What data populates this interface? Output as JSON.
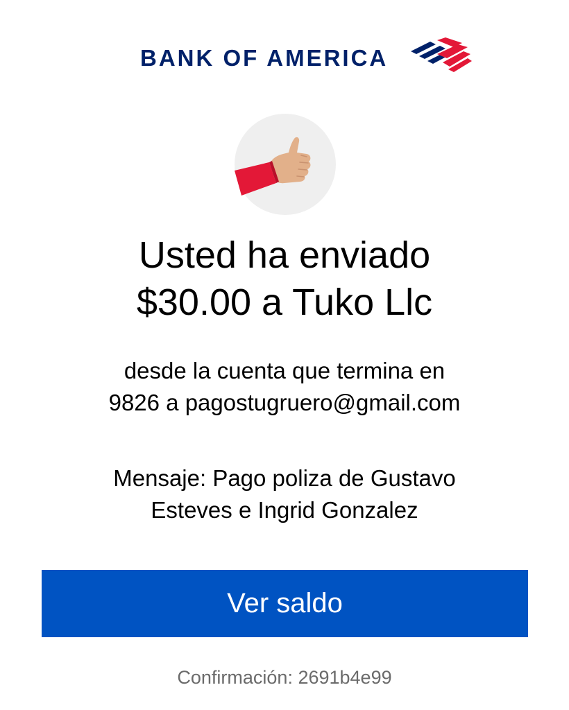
{
  "brand": {
    "name": "BANK OF AMERICA",
    "logo_icon": "bank-of-america-flag-icon",
    "colors": {
      "navy": "#012169",
      "red": "#e31837",
      "button_blue": "#0053c2"
    }
  },
  "confirmation_icon": "thumbs-up-icon",
  "headline": {
    "line1": "Usted ha enviado",
    "line2": "$30.00 a Tuko Llc"
  },
  "account_detail": {
    "line1": "desde la cuenta que termina en",
    "line2": "9826 a pagostugruero@gmail.com"
  },
  "message": {
    "line1": "Mensaje: Pago poliza de Gustavo",
    "line2": "Esteves e Ingrid Gonzalez"
  },
  "actions": {
    "view_balance_label": "Ver saldo"
  },
  "confirmation": {
    "text": "Confirmación: 2691b4e99"
  }
}
